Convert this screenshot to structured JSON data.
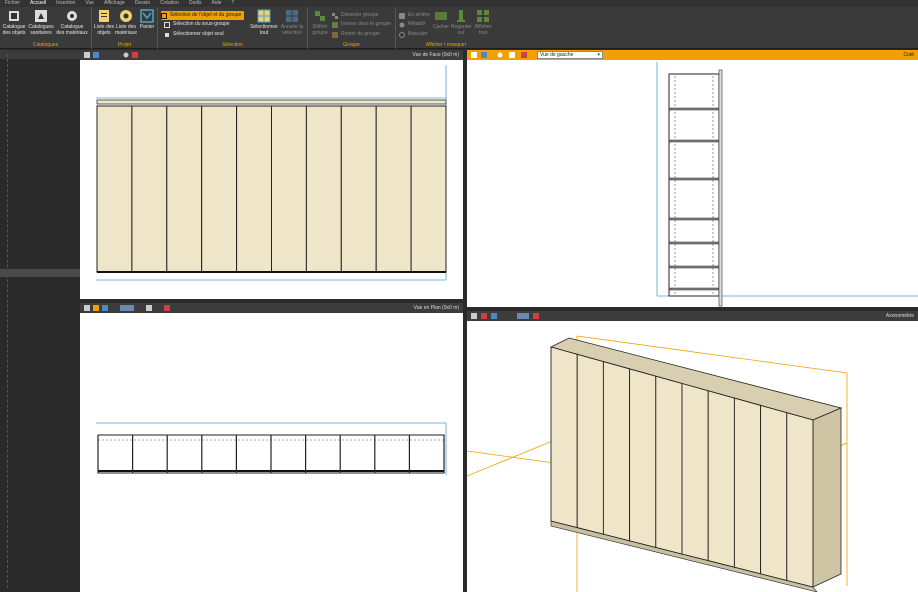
{
  "menubar": [
    "Fichier",
    "Accueil",
    "Insertion",
    "Vue",
    "Affichage",
    "Dessin",
    "Cotation",
    "Outils",
    "Aide",
    "?"
  ],
  "ribbon": {
    "catalogues": {
      "label": "Catalogues",
      "objects": "Catalogue\ndes objets",
      "sanitary": "Catalogues\nsanitaires",
      "materials": "Catalogue\ndes matériaux"
    },
    "projet": {
      "label": "Projet",
      "objects_list": "Liste des\nobjets",
      "materials_list": "Liste des\nmatériaux",
      "basket": "Panier"
    },
    "selection": {
      "label": "Sélection",
      "select_object_group": "Sélection de l'objet et du groupe",
      "select_subgroup": "Sélection du sous-groupe",
      "select_single": "Sélectionner objet seul",
      "select_all": "Sélectionner\ntout",
      "cancel_selection": "Annuler la\nsélection"
    },
    "groupe": {
      "label": "Groupe",
      "define": "Définir\ngroupe",
      "dissociate": "Dissocier groupe",
      "insert": "Insérer dans le groupe",
      "remove": "Retirer du groupe"
    },
    "afficher": {
      "label": "Afficher / masquer",
      "behind": "En arrière",
      "restore": "Rétablir",
      "toggle": "Basculer",
      "hide": "Cacher",
      "look_out": "Regarder\nout",
      "show_all": "Afficher\ntout"
    }
  },
  "viewports": {
    "top_left": {
      "title": "Vue de Face  (0x0 m)"
    },
    "top_right": {
      "title": "Coté",
      "select_value": "Vue de gauche"
    },
    "bottom_left": {
      "title": "Vue en Plan  (0x0 m)"
    },
    "bottom_right": {
      "title": "Axonométrie"
    }
  },
  "colors": {
    "panel": "#efe5c8",
    "accent": "#f0a000",
    "guide": "#4aa8c8"
  }
}
